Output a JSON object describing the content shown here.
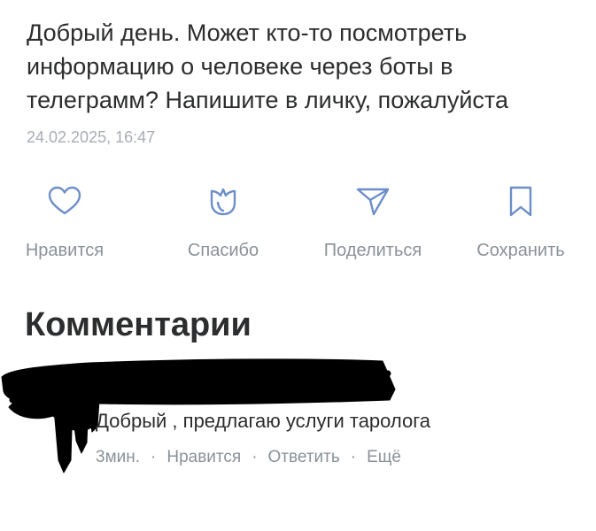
{
  "post": {
    "text": "Добрый день. Может кто-то посмотреть\nинформацию о человеке через боты в\nтелеграмм? Напишите в личку, пожалуйста",
    "date": "24.02.2025, 16:47"
  },
  "actions": [
    {
      "label": "Нравится",
      "icon": "heart-icon"
    },
    {
      "label": "Спасибо",
      "icon": "tulip-icon"
    },
    {
      "label": "Поделиться",
      "icon": "send-icon"
    },
    {
      "label": "Сохранить",
      "icon": "bookmark-icon"
    }
  ],
  "comments": {
    "title": "Комментарии",
    "items": [
      {
        "text": "Добрый , предлагаю услуги таролога",
        "time": "3мин.",
        "like_label": "Нравится",
        "reply_label": "Ответить",
        "more_label": "Ещё",
        "separator": "·"
      }
    ]
  },
  "colors": {
    "text": "#2c2d2e",
    "secondary": "#8a9199",
    "date": "#a8adb3",
    "icon": "#6d8ec9",
    "redaction": "#000000"
  }
}
